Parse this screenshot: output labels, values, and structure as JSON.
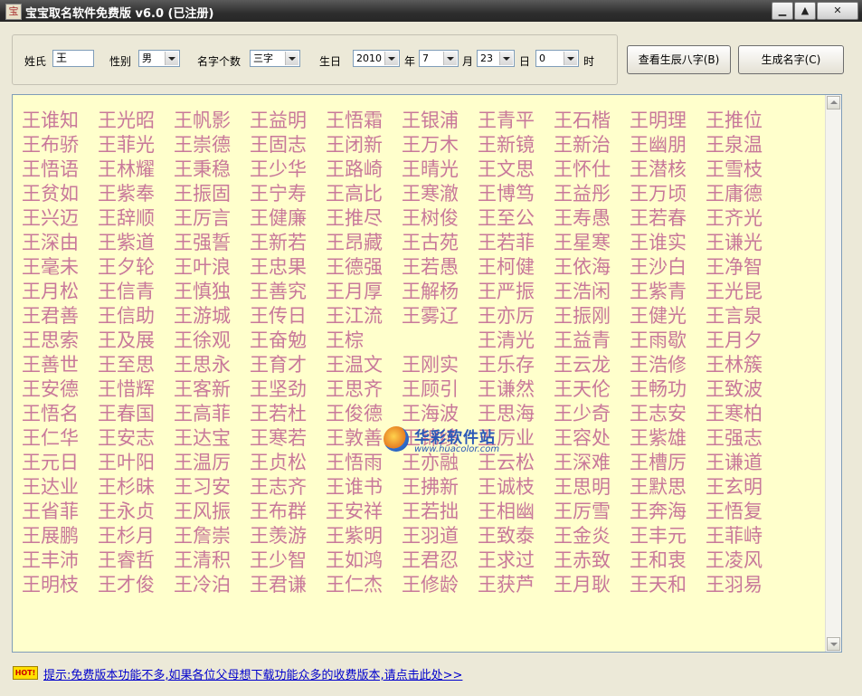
{
  "window": {
    "title": "宝宝取名软件免费版 v6.0 (已注册)",
    "min_label": "▁",
    "max_label": "▲",
    "close_label": "✕"
  },
  "form": {
    "surname_label": "姓氏",
    "surname_value": "王",
    "gender_label": "性别",
    "gender_value": "男",
    "name_count_label": "名字个数",
    "name_count_value": "三字",
    "birth_label": "生日",
    "year_value": "2010",
    "year_unit": "年",
    "month_value": "7",
    "month_unit": "月",
    "day_value": "23",
    "day_unit": "日",
    "hour_value": "0",
    "hour_unit": "时"
  },
  "buttons": {
    "bazi": "查看生辰八字(B)",
    "generate": "生成名字(C)"
  },
  "names": [
    "王谁知",
    "王光昭",
    "王帆影",
    "王益明",
    "王悟霜",
    "王银浦",
    "王青平",
    "王石楷",
    "王明理",
    "王推位",
    "王布骄",
    "王菲光",
    "王崇德",
    "王固志",
    "王闭新",
    "王万木",
    "王新镜",
    "王新治",
    "王幽朋",
    "王泉温",
    "王悟语",
    "王林耀",
    "王秉稳",
    "王少华",
    "王路崎",
    "王晴光",
    "王文思",
    "王怀仕",
    "王潜核",
    "王雪枝",
    "王贫如",
    "王紫奉",
    "王振固",
    "王宁寿",
    "王高比",
    "王寒澈",
    "王博笃",
    "王益彤",
    "王万顷",
    "王庸德",
    "王兴迈",
    "王辞顺",
    "王厉言",
    "王健廉",
    "王推尽",
    "王树俊",
    "王至公",
    "王寿愚",
    "王若春",
    "王齐光",
    "王深由",
    "王紫道",
    "王强誓",
    "王新若",
    "王昂藏",
    "王古苑",
    "王若菲",
    "王星寒",
    "王谁实",
    "王谦光",
    "王毫未",
    "王夕轮",
    "王叶浪",
    "王忠果",
    "王德强",
    "王若愚",
    "王柯健",
    "王依海",
    "王沙白",
    "王净智",
    "王月松",
    "王信青",
    "王慎独",
    "王善究",
    "王月厚",
    "王解杨",
    "王严振",
    "王浩闲",
    "王紫青",
    "王光昆",
    "王君善",
    "王信助",
    "王游城",
    "王传日",
    "王江流",
    "王雾辽",
    "王亦厉",
    "王振刚",
    "王健光",
    "王言泉",
    "王思索",
    "王及展",
    "王徐观",
    "王奋勉",
    "王棕",
    "",
    "王清光",
    "王益青",
    "王雨歇",
    "王月夕",
    "王善世",
    "王至思",
    "王思永",
    "王育才",
    "王温文",
    "王刚实",
    "王乐存",
    "王云龙",
    "王浩修",
    "王林簇",
    "王安德",
    "王惜辉",
    "王客新",
    "王坚劲",
    "王思齐",
    "王顾引",
    "王谦然",
    "王天伦",
    "王畅功",
    "王致波",
    "王悟名",
    "王春国",
    "王高菲",
    "王若杜",
    "王俊德",
    "王海波",
    "王思海",
    "王少奇",
    "王志安",
    "王寒柏",
    "王仁华",
    "王安志",
    "王达宝",
    "王寒若",
    "王敦善",
    "王锦绩",
    "王厉业",
    "王容处",
    "王紫雄",
    "王强志",
    "王元日",
    "王叶阳",
    "王温厉",
    "王贞松",
    "王悟雨",
    "王亦融",
    "王云松",
    "王深难",
    "王槽厉",
    "王谦道",
    "王达业",
    "王杉昧",
    "王习安",
    "王志齐",
    "王谁书",
    "王拂新",
    "王诚枝",
    "王思明",
    "王默思",
    "王玄明",
    "王省菲",
    "王永贞",
    "王风振",
    "王布群",
    "王安祥",
    "王若拙",
    "王相幽",
    "王厉雪",
    "王奔海",
    "王悟复",
    "王展鹏",
    "王杉月",
    "王詹崇",
    "王羡游",
    "王紫明",
    "王羽道",
    "王致泰",
    "王金炎",
    "王丰元",
    "王菲峙",
    "王丰沛",
    "王睿哲",
    "王清积",
    "王少智",
    "王如鸿",
    "王君忍",
    "王求过",
    "王赤致",
    "王和衷",
    "王凌风",
    "王明枝",
    "王才俊",
    "王冷泊",
    "王君谦",
    "王仁杰",
    "王修龄",
    "王获芦",
    "王月耿",
    "王天和",
    "王羽易"
  ],
  "watermark": {
    "text": "华彩软件站",
    "sub": "www.huacolor.com"
  },
  "hint": {
    "icon": "HOT!",
    "text": "提示:免费版本功能不多,如果各位父母想下载功能众多的收费版本,请点击此处>>"
  },
  "colors": {
    "name_text": "#c8789a",
    "names_background": "#ffffcc",
    "link": "#0000cc"
  },
  "icons": [
    "app-icon",
    "minimize-icon",
    "maximize-icon",
    "close-icon",
    "dropdown-arrow-icon",
    "scroll-up-icon",
    "scroll-down-icon",
    "hot-icon"
  ]
}
